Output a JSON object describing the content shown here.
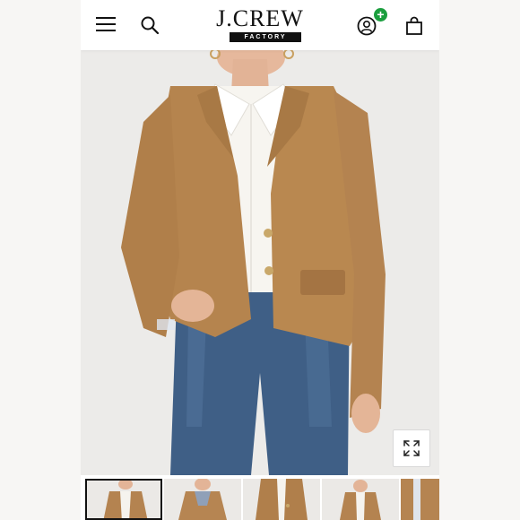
{
  "header": {
    "menu_icon": "hamburger-menu-icon",
    "search_icon": "search-icon",
    "logo": {
      "brand": "J.CREW",
      "sub": "FACTORY"
    },
    "account_icon": "account-icon",
    "account_badge": "+",
    "bag_icon": "shopping-bag-icon",
    "badge_color": "#1b9e3e"
  },
  "product": {
    "image_alt": "Woman wearing camel two-button blazer over white shirt and blue jeans",
    "expand_icon": "expand-icon"
  },
  "thumbnails": [
    {
      "label": "thumbnail-1",
      "active": true
    },
    {
      "label": "thumbnail-2",
      "active": false
    },
    {
      "label": "thumbnail-3",
      "active": false
    },
    {
      "label": "thumbnail-4",
      "active": false
    },
    {
      "label": "thumbnail-5",
      "active": false
    }
  ]
}
